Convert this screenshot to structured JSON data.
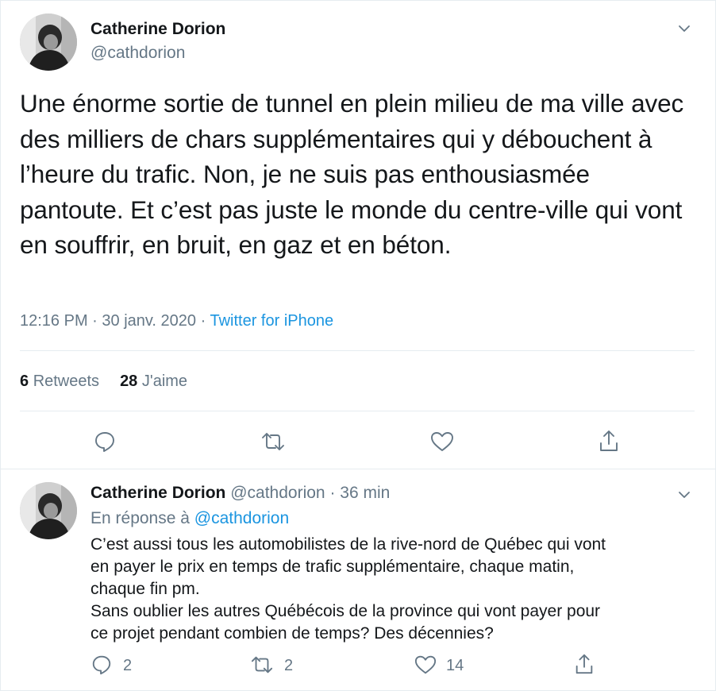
{
  "main_tweet": {
    "author_name": "Catherine Dorion",
    "author_handle": "@cathdorion",
    "text": "Une énorme sortie de tunnel en plein milieu de ma ville avec des milliers de chars supplémentaires qui y débouchent à l’heure du trafic. Non, je ne suis pas enthousiasmée pantoute. Et c’est pas juste le monde du centre-ville qui vont en souffrir, en bruit, en gaz et en béton.",
    "time": "12:16 PM",
    "date": "30 janv. 2020",
    "separator": "·",
    "source": "Twitter for iPhone",
    "retweets_count": "6",
    "retweets_label": "Retweets",
    "likes_count": "28",
    "likes_label": "J'aime",
    "actions": [
      "reply-icon",
      "retweet-icon",
      "like-icon",
      "share-icon"
    ]
  },
  "reply_tweet": {
    "author_name": "Catherine Dorion",
    "author_handle": "@cathdorion",
    "separator": "·",
    "time_ago": "36 min",
    "in_reply_prefix": "En réponse à",
    "in_reply_mention": "@cathdorion",
    "text_lines": [
      "C’est aussi tous les automobilistes de la rive-nord de Québec qui vont",
      "en payer le prix en temps de trafic supplémentaire, chaque matin,",
      "chaque fin pm.",
      "Sans oublier les autres Québécois de la province qui vont payer pour",
      "ce projet pendant combien de temps? Des décennies?"
    ],
    "reply_count": "2",
    "retweet_count": "2",
    "like_count": "14"
  },
  "colors": {
    "text": "#14171a",
    "secondary": "#657786",
    "link": "#1b95e0",
    "divider": "#e6ecf0"
  }
}
